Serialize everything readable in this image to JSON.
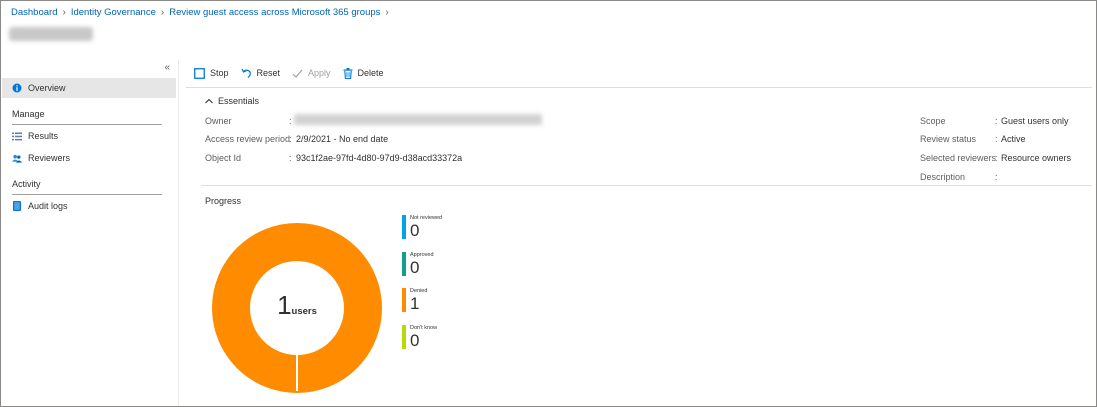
{
  "breadcrumb": [
    "Dashboard",
    "Identity Governance",
    "Review guest access across Microsoft 365 groups"
  ],
  "sidebar": {
    "collapse_icon": "«",
    "overview": "Overview",
    "manage_section": "Manage",
    "results": "Results",
    "reviewers": "Reviewers",
    "activity_section": "Activity",
    "audit_logs": "Audit logs"
  },
  "toolbar": {
    "stop": "Stop",
    "reset": "Reset",
    "apply": "Apply",
    "delete": "Delete"
  },
  "essentials": {
    "toggle_label": "Essentials",
    "left": [
      {
        "label": "Owner",
        "value": ""
      },
      {
        "label": "Access review period",
        "value": "2/9/2021 - No end date"
      },
      {
        "label": "Object Id",
        "value": "93c1f2ae-97fd-4d80-97d9-d38acd33372a"
      }
    ],
    "right": [
      {
        "label": "Scope",
        "value": "Guest users only"
      },
      {
        "label": "Review status",
        "value": "Active"
      },
      {
        "label": "Selected reviewers",
        "value": "Resource owners"
      },
      {
        "label": "Description",
        "value": ""
      }
    ]
  },
  "progress": {
    "title": "Progress",
    "total": "1",
    "unit": "users",
    "legend": [
      {
        "label": "Not reviewed",
        "value": "0",
        "color": "#00a2e8"
      },
      {
        "label": "Approved",
        "value": "0",
        "color": "#13a086"
      },
      {
        "label": "Denied",
        "value": "1",
        "color": "#ff8c00"
      },
      {
        "label": "Don't know",
        "value": "0",
        "color": "#bad80a"
      }
    ]
  },
  "colors": {
    "link": "#0063b1",
    "donut": "#ff8c00",
    "info_icon": "#0078d4"
  }
}
